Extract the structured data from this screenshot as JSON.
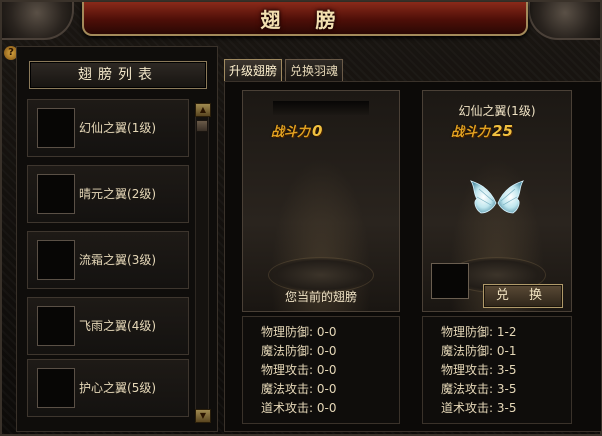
{
  "title": "翅 膀",
  "help_icon": "question-icon",
  "close_icon": "close-icon",
  "list_header": "翅膀列表",
  "wings": [
    {
      "name": "幻仙之翼",
      "level": "(1级)"
    },
    {
      "name": "晴元之翼",
      "level": "(2级)"
    },
    {
      "name": "流霜之翼",
      "level": "(3级)"
    },
    {
      "name": "飞雨之翼",
      "level": "(4级)"
    },
    {
      "name": "护心之翼",
      "level": "(5级)"
    }
  ],
  "tabs": [
    {
      "label": "升级翅膀",
      "active": true
    },
    {
      "label": "兑换羽魂",
      "active": false
    }
  ],
  "current": {
    "power_label": "战斗力",
    "power_value": "0",
    "caption": "您当前的翅膀",
    "stats": [
      {
        "label": "物理防御:",
        "value": "0-0"
      },
      {
        "label": "魔法防御:",
        "value": "0-0"
      },
      {
        "label": "物理攻击:",
        "value": "0-0"
      },
      {
        "label": "魔法攻击:",
        "value": "0-0"
      },
      {
        "label": "道术攻击:",
        "value": "0-0"
      }
    ]
  },
  "target": {
    "name": "幻仙之翼(1级)",
    "power_label": "战斗力",
    "power_value": "25",
    "exchange_label": "兑 换",
    "stats": [
      {
        "label": "物理防御:",
        "value": "1-2"
      },
      {
        "label": "魔法防御:",
        "value": "0-1"
      },
      {
        "label": "物理攻击:",
        "value": "3-5"
      },
      {
        "label": "魔法攻击:",
        "value": "3-5"
      },
      {
        "label": "道术攻击:",
        "value": "3-5"
      }
    ]
  },
  "colors": {
    "accent": "#e0a020",
    "banner": "#6a1a10",
    "border": "#a38a5a"
  }
}
